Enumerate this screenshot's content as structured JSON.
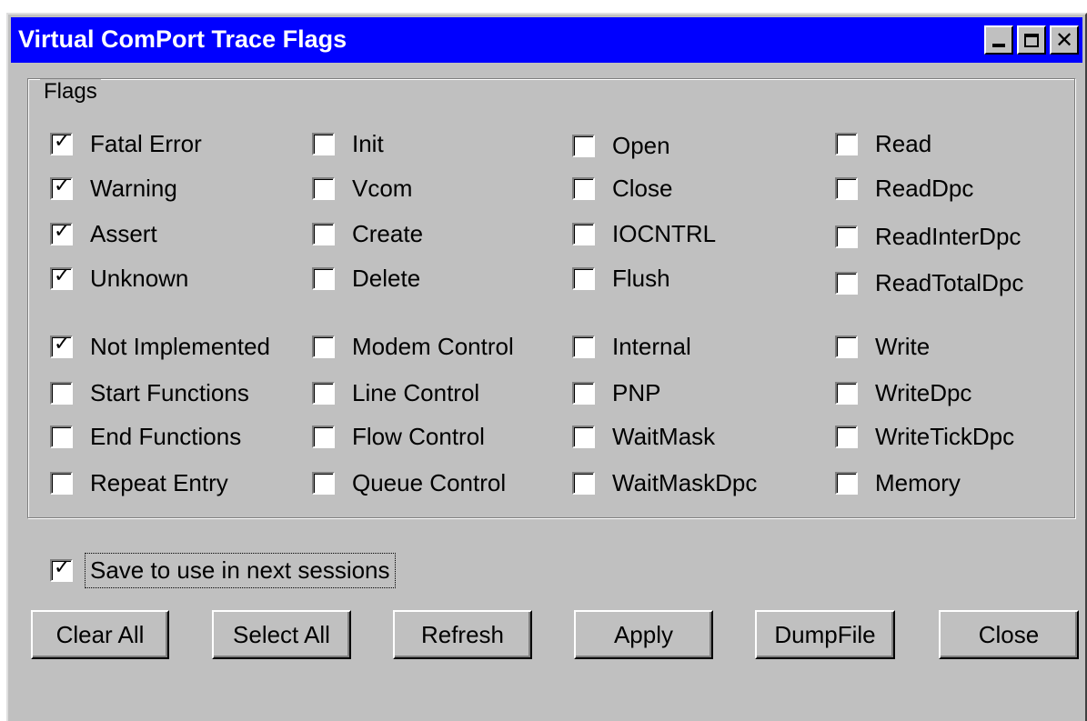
{
  "window": {
    "title": "Virtual ComPort Trace Flags"
  },
  "flags_group": {
    "label": "Flags",
    "col1": [
      {
        "label": "Fatal Error",
        "checked": true
      },
      {
        "label": "Warning",
        "checked": true
      },
      {
        "label": "Assert",
        "checked": true
      },
      {
        "label": "Unknown",
        "checked": true
      },
      {
        "label": "Not Implemented",
        "checked": true
      },
      {
        "label": "Start Functions",
        "checked": false
      },
      {
        "label": "End Functions",
        "checked": false
      },
      {
        "label": "Repeat Entry",
        "checked": false
      }
    ],
    "col2": [
      {
        "label": "Init",
        "checked": false
      },
      {
        "label": "Vcom",
        "checked": false
      },
      {
        "label": "Create",
        "checked": false
      },
      {
        "label": "Delete",
        "checked": false
      },
      {
        "label": "Modem Control",
        "checked": false
      },
      {
        "label": "Line Control",
        "checked": false
      },
      {
        "label": "Flow Control",
        "checked": false
      },
      {
        "label": "Queue Control",
        "checked": false
      }
    ],
    "col3": [
      {
        "label": "Open",
        "checked": false
      },
      {
        "label": "Close",
        "checked": false
      },
      {
        "label": "IOCNTRL",
        "checked": false
      },
      {
        "label": "Flush",
        "checked": false
      },
      {
        "label": "Internal",
        "checked": false
      },
      {
        "label": "PNP",
        "checked": false
      },
      {
        "label": "WaitMask",
        "checked": false
      },
      {
        "label": "WaitMaskDpc",
        "checked": false
      }
    ],
    "col4": [
      {
        "label": "Read",
        "checked": false
      },
      {
        "label": "ReadDpc",
        "checked": false
      },
      {
        "label": "ReadInterDpc",
        "checked": false
      },
      {
        "label": "ReadTotalDpc",
        "checked": false
      },
      {
        "label": "Write",
        "checked": false
      },
      {
        "label": "WriteDpc",
        "checked": false
      },
      {
        "label": "WriteTickDpc",
        "checked": false
      },
      {
        "label": "Memory",
        "checked": false
      }
    ]
  },
  "save_option": {
    "label": "Save to use in next sessions",
    "checked": true
  },
  "buttons": {
    "clear_all": "Clear All",
    "select_all": "Select All",
    "refresh": "Refresh",
    "apply": "Apply",
    "dumpfile": "DumpFile",
    "close": "Close"
  },
  "colors": {
    "titlebar": "#0000ff",
    "face": "#c0c0c0"
  }
}
